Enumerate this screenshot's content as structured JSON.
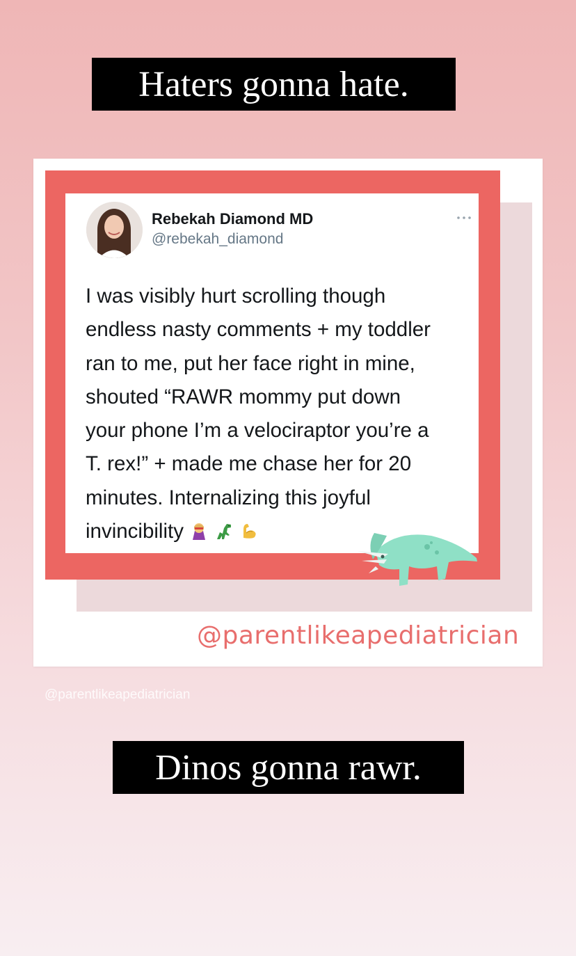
{
  "caption_top": "Haters gonna hate.",
  "caption_bottom": "Dinos gonna rawr.",
  "tweet": {
    "author_name": "Rebekah Diamond MD",
    "author_handle": "@rebekah_diamond",
    "more_icon": "ellipsis-icon",
    "lines": [
      "I was visibly hurt scrolling though",
      "endless nasty comments + my toddler",
      "ran to me, put her face right in mine,",
      "shouted “RAWR mommy put down",
      "your phone I’m a velociraptor you’re a",
      "T. rex!” + made me chase her for 20",
      "minutes. Internalizing this joyful",
      "invincibility"
    ],
    "emojis": [
      "superhero-emoji",
      "t-rex-emoji",
      "flexed-biceps-emoji"
    ]
  },
  "card_handle": "@parentlikeapediatrician",
  "watermark": "@parentlikeapediatrician",
  "colors": {
    "frame_red": "#ec6662",
    "handle_pink": "#e86e6d",
    "dino_mint": "#8fe0c6"
  }
}
